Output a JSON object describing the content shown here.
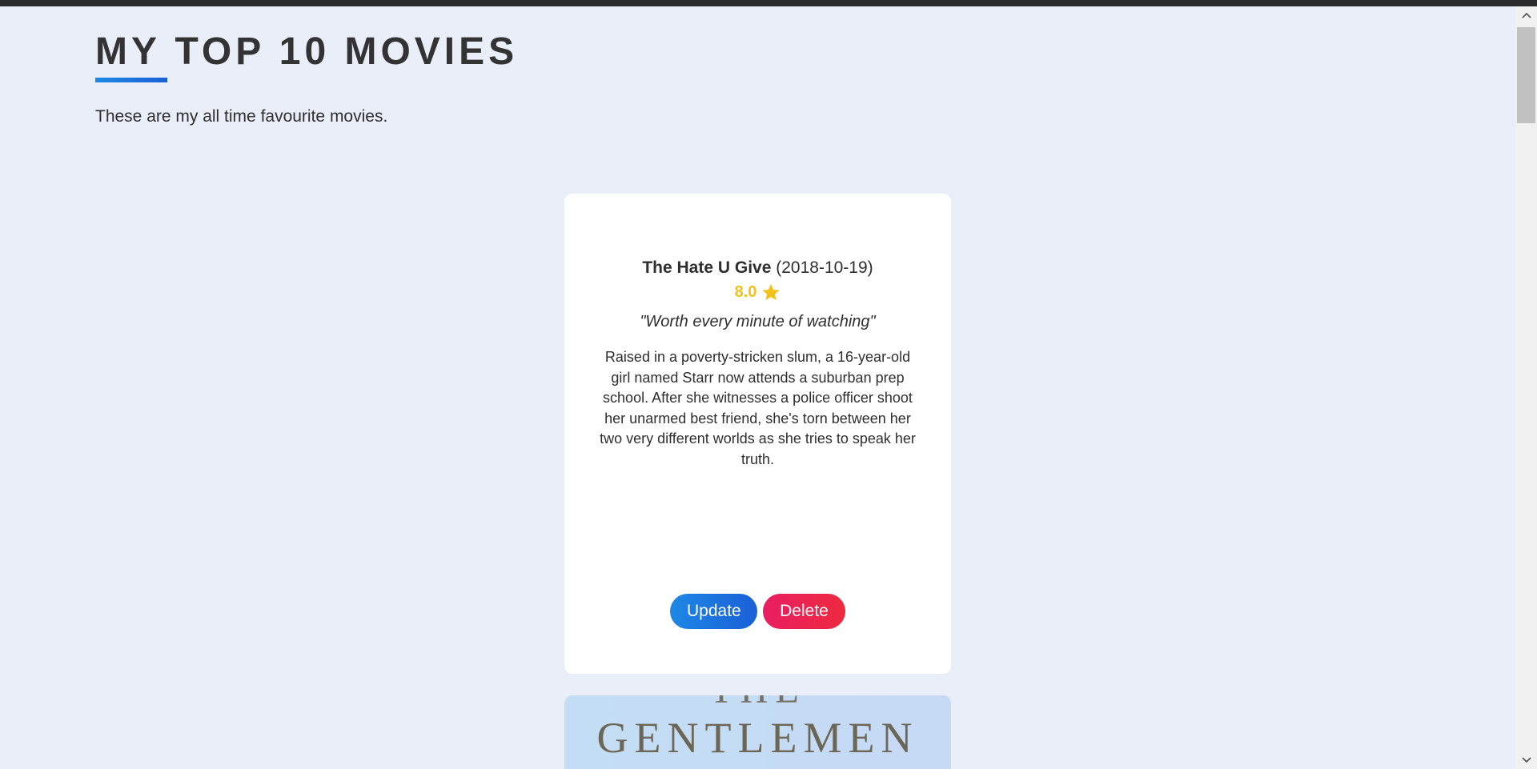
{
  "header": {
    "title": "MY TOP 10 MOVIES",
    "subtitle": "These are my all time favourite movies."
  },
  "movies": [
    {
      "title": "The Hate U Give",
      "date": "(2018-10-19)",
      "rating": "8.0",
      "review": "\"Worth every minute of watching\"",
      "description": "Raised in a poverty-stricken slum, a 16-year-old girl named Starr now attends a suburban prep school. After she witnesses a police officer shoot her unarmed best friend, she's torn between her two very different worlds as she tries to speak her truth.",
      "update_label": "Update",
      "delete_label": "Delete"
    },
    {
      "poster_text_partial": "THE",
      "poster_text": "GENTLEMEN"
    }
  ],
  "icons": {
    "rating": "star-icon",
    "scroll_up": "chevron-up-icon",
    "scroll_down": "chevron-down-icon"
  },
  "colors": {
    "background": "#e9eef8",
    "accent_blue": "#1e88e5",
    "accent_red": "#e91e63",
    "rating_gold": "#f2c21b"
  }
}
